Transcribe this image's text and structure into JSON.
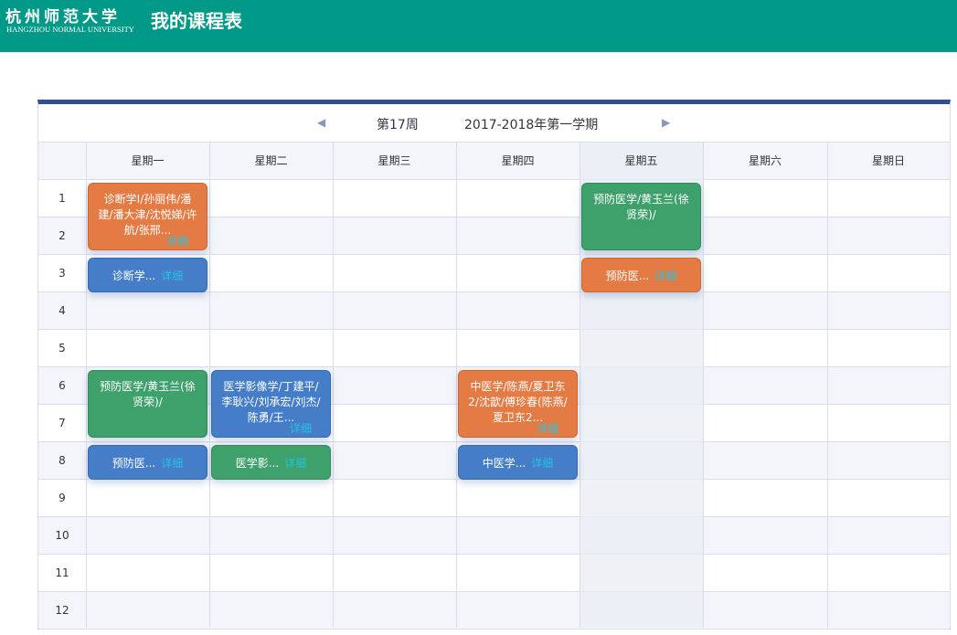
{
  "header": {
    "logo_cn": "杭州师范大学",
    "logo_en": "HANGZHOU NORMAL UNIVERSITY",
    "title": "我的课程表"
  },
  "week_nav": {
    "prev_icon": "◀",
    "week": "第17周",
    "term": "2017-2018年第一学期",
    "next_icon": "▶"
  },
  "days": [
    "星期一",
    "星期二",
    "星期三",
    "星期四",
    "星期五",
    "星期六",
    "星期日"
  ],
  "periods": [
    "1",
    "2",
    "3",
    "4",
    "5",
    "6",
    "7",
    "8",
    "9",
    "10",
    "11",
    "12"
  ],
  "highlighted_day": "星期五",
  "detail_label": "详细",
  "courses": [
    {
      "text": "诊断学Ⅰ/孙丽伟/潘建/潘大津/沈悦娣/许航/张邢...",
      "color": "orange"
    },
    {
      "text": "诊断学...",
      "color": "blue"
    },
    {
      "text": "预防医学/黄玉兰(徐贤荣)/",
      "color": "green"
    },
    {
      "text": "预防医...",
      "color": "blue"
    },
    {
      "text": "医学影像学/丁建平/李耿兴/刘承宏/刘杰/陈勇/王...",
      "color": "blue"
    },
    {
      "text": "医学影...",
      "color": "green"
    },
    {
      "text": "中医学/陈燕/夏卫东2/沈歆/傅珍春(陈燕/夏卫东2...",
      "color": "orange"
    },
    {
      "text": "中医学...",
      "color": "blue"
    },
    {
      "text": "预防医学/黄玉兰(徐贤荣)/",
      "color": "green"
    },
    {
      "text": "预防医...",
      "color": "orange"
    }
  ],
  "colors": {
    "header": "#009987",
    "orange": "#e47b44",
    "green": "#3ea06a",
    "blue": "#457dc8",
    "detail": "#25c4e0"
  }
}
